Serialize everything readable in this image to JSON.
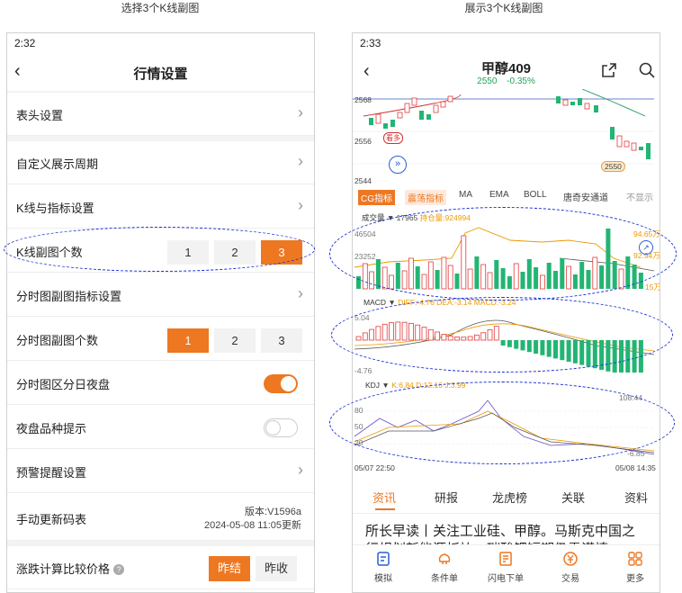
{
  "captions": {
    "left": "选择3个K线副图",
    "right": "展示3个K线副图"
  },
  "left_screen": {
    "status_time": "2:32",
    "back_icon": "back-chevron-icon",
    "title": "行情设置",
    "rows": {
      "header_settings": "表头设置",
      "custom_period": "自定义展示周期",
      "kline_indicator": "K线与指标设置",
      "kline_sub_count": "K线副图个数",
      "timeshare_indicator": "分时图副图指标设置",
      "timeshare_sub_count": "分时图副图个数",
      "timeshare_day_night": "分时图区分日夜盘",
      "night_hint": "夜盘品种提示",
      "alert_settings": "预警提醒设置",
      "manual_update": "手动更新码表",
      "price_compare": "涨跌计算比较价格"
    },
    "kline_sub_options": [
      "1",
      "2",
      "3"
    ],
    "kline_sub_selected": "3",
    "timeshare_sub_options": [
      "1",
      "2",
      "3"
    ],
    "timeshare_sub_selected": "1",
    "toggle_day_night": true,
    "toggle_night_hint": false,
    "version_line": "版本:V1596a",
    "update_time": "2024-05-08 11:05更新",
    "price_options": [
      "昨结",
      "昨收"
    ],
    "price_selected": "昨结",
    "accent_color": "#ee7722"
  },
  "right_screen": {
    "status_time": "2:33",
    "title": "甲醇409",
    "last_price": "2550",
    "change_pct": "-0.35%",
    "share_icon": "share-icon",
    "search_icon": "search-icon",
    "main_axis": [
      "2568",
      "2556",
      "2544"
    ],
    "kan_duo_label": "看多",
    "last_tag": "2550",
    "indicator_tabs": [
      "CG指标",
      "震荡指标",
      "MA",
      "EMA",
      "BOLL",
      "唐奇安通道",
      "不显示"
    ],
    "volume": {
      "label": "成交量",
      "vol_value": "17965",
      "oi_label": "持仓量:924994",
      "axis": [
        "46504",
        "23252"
      ],
      "right_labels": [
        "94.65万",
        "92.94万",
        "15万"
      ]
    },
    "macd": {
      "label": "MACD",
      "values": "DIFF:-4.76  DEA:-3.14  MACD:-3.24",
      "axis_top": "5.04",
      "axis_bottom": "-4.76"
    },
    "kdj": {
      "label": "KDJ",
      "values": "K:6.84  D:12.16  J:3.99",
      "axis": [
        "80",
        "50",
        "20"
      ],
      "axis_top": "108.44",
      "axis_bottom": "-6.85"
    },
    "time_start": "05/07 22:50",
    "time_end": "05/08 14:35",
    "news_tabs": [
      "资讯",
      "研报",
      "龙虎榜",
      "关联",
      "资料"
    ],
    "news_active": "资讯",
    "news_headline": "所长早读丨关注工业硅、甲醇。马斯克中国之",
    "news_headline2": "行规划新能源板块，碳酸锂短期仍需谨慎",
    "bottom_nav": [
      {
        "label": "模拟",
        "icon": "simulate-icon"
      },
      {
        "label": "条件单",
        "icon": "condition-order-icon"
      },
      {
        "label": "闪电下单",
        "icon": "flash-order-icon"
      },
      {
        "label": "交易",
        "icon": "trade-icon"
      },
      {
        "label": "更多",
        "icon": "more-icon"
      }
    ],
    "colors": {
      "up": "#e23b3b",
      "down": "#22b573",
      "accent": "#ee7722",
      "annotation": "#1a2fd0"
    }
  }
}
